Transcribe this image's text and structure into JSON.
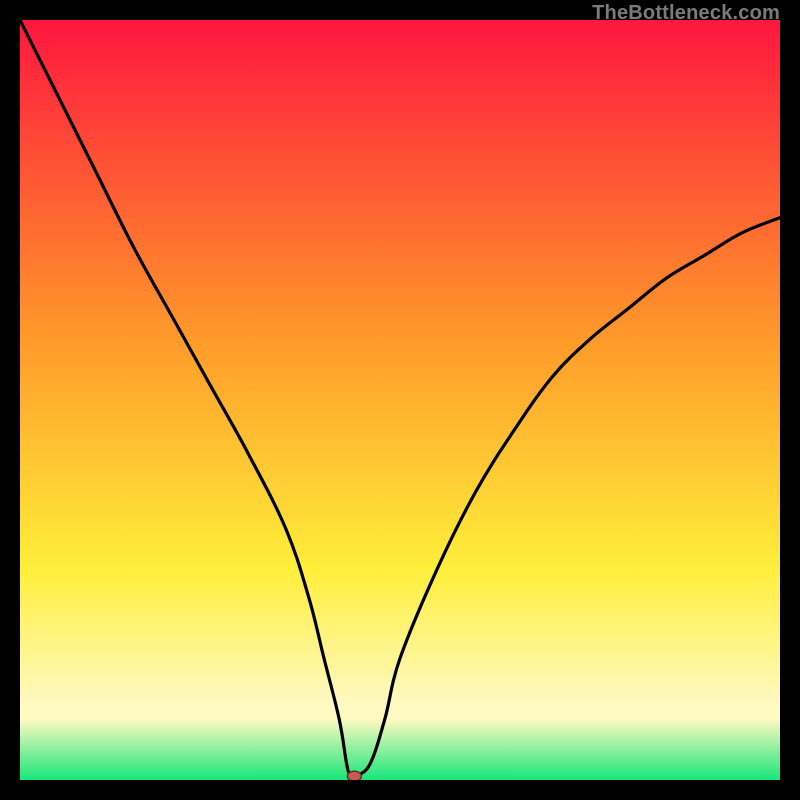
{
  "watermark": "TheBottleneck.com",
  "colors": {
    "frame": "#000000",
    "curve": "#000000",
    "marker_fill": "#c95b50",
    "marker_stroke": "#5a2f2a",
    "gradient_top": "#ff163f",
    "gradient_mid1": "#ff9a2a",
    "gradient_mid2": "#ffee3a",
    "gradient_bottom_band": "#fff9c2",
    "gradient_bottom": "#18e67a"
  },
  "chart_data": {
    "type": "line",
    "title": "",
    "xlabel": "",
    "ylabel": "",
    "xlim": [
      0,
      100
    ],
    "ylim": [
      0,
      100
    ],
    "grid": false,
    "legend": false,
    "x": [
      0,
      5,
      10,
      15,
      20,
      25,
      30,
      35,
      38,
      40,
      42,
      43,
      43.5,
      44,
      46,
      48,
      50,
      55,
      60,
      65,
      70,
      75,
      80,
      85,
      90,
      95,
      100
    ],
    "values": [
      100,
      90,
      80,
      70,
      61,
      52,
      43,
      33,
      24,
      16,
      8,
      2,
      0.5,
      0.5,
      2,
      8,
      16,
      28,
      38,
      46,
      53,
      58,
      62,
      66,
      69,
      72,
      74
    ],
    "marker": {
      "x": 44,
      "y": 0.5
    },
    "annotations": []
  }
}
